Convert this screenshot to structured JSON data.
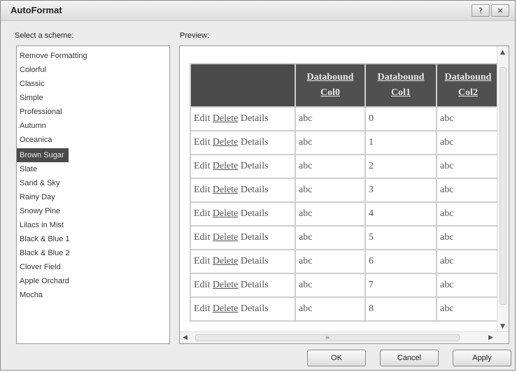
{
  "window": {
    "title": "AutoFormat"
  },
  "labels": {
    "select_scheme": "Select a scheme:",
    "preview": "Preview:"
  },
  "schemes": [
    "Remove Formatting",
    "Colorful",
    "Classic",
    "Simple",
    "Professional",
    "Autumn",
    "Oceanica",
    "Brown Sugar",
    "Slate",
    "Sand & Sky",
    "Rainy Day",
    "Snowy Pine",
    "Lilacs in Mist",
    "Black & Blue 1",
    "Black & Blue 2",
    "Clover Field",
    "Apple Orchard",
    "Mocha"
  ],
  "selected_scheme": "Brown Sugar",
  "grid": {
    "headers": [
      {
        "line1": "Databound",
        "line2": "Col0"
      },
      {
        "line1": "Databound",
        "line2": "Col1"
      },
      {
        "line1": "Databound",
        "line2": "Col2"
      }
    ],
    "action_links": {
      "edit": "Edit",
      "delete": "Delete",
      "details": "Details"
    },
    "rows": [
      {
        "c0": "abc",
        "c1": "0",
        "c2": "abc"
      },
      {
        "c0": "abc",
        "c1": "1",
        "c2": "abc"
      },
      {
        "c0": "abc",
        "c1": "2",
        "c2": "abc"
      },
      {
        "c0": "abc",
        "c1": "3",
        "c2": "abc"
      },
      {
        "c0": "abc",
        "c1": "4",
        "c2": "abc"
      },
      {
        "c0": "abc",
        "c1": "5",
        "c2": "abc"
      },
      {
        "c0": "abc",
        "c1": "6",
        "c2": "abc"
      },
      {
        "c0": "abc",
        "c1": "7",
        "c2": "abc"
      },
      {
        "c0": "abc",
        "c1": "8",
        "c2": "abc"
      }
    ]
  },
  "buttons": {
    "ok": "OK",
    "cancel": "Cancel",
    "apply": "Apply"
  },
  "icons": {
    "help": "help-icon",
    "close": "close-icon"
  }
}
